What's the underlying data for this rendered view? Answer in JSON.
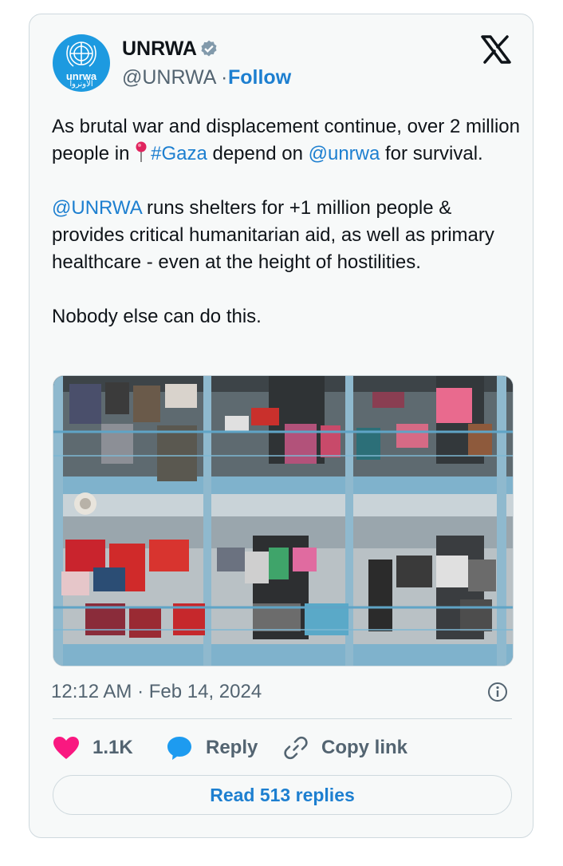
{
  "author": {
    "name": "UNRWA",
    "handle": "@UNRWA",
    "separator": " · ",
    "follow_label": "Follow",
    "avatar_text": "unrwa",
    "avatar_text_ar": "الأونروا",
    "verified_icon": "verified-badge-icon",
    "brand_color": "#1d9ae0"
  },
  "platform_icon": "x-logo-icon",
  "tweet": {
    "line1": "As brutal war and displacement continue, over 2 million people in ",
    "hashtag": "#Gaza",
    "line1b": " depend on ",
    "mention1": "@unrwa",
    "line1c": " for survival.",
    "mention2": "@UNRWA",
    "para2": " runs shelters for +1 million people & provides critical humanitarian aid, as well as primary healthcare - even at the height of hostilities.",
    "para3": "Nobody else can do this."
  },
  "media": {
    "description_icon": "photo-shelter-laundry"
  },
  "timestamp": "12:12 AM · Feb 14, 2024",
  "actions": {
    "likes_count": "1.1K",
    "reply_label": "Reply",
    "copy_label": "Copy link"
  },
  "read_replies_label": "Read 513 replies",
  "colors": {
    "link": "#1d7fd0",
    "like": "#f91880",
    "reply_icon": "#1d9bf0",
    "secondary_text": "#536471"
  }
}
